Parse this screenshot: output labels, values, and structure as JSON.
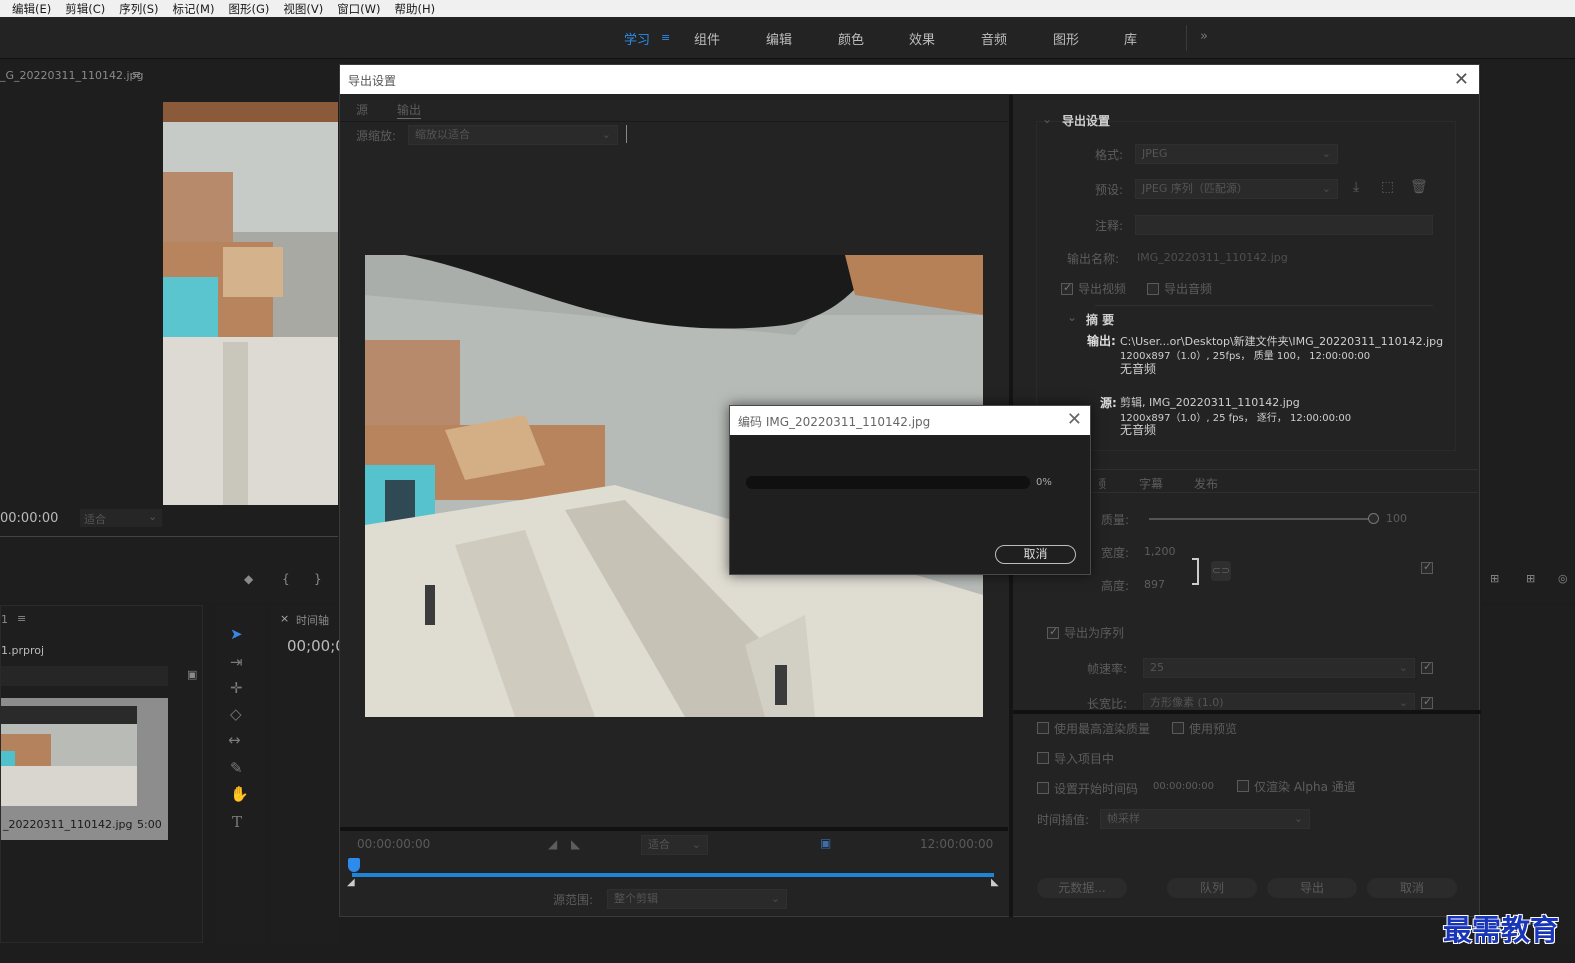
{
  "menu": [
    "编辑(E)",
    "剪辑(C)",
    "序列(S)",
    "标记(M)",
    "图形(G)",
    "视图(V)",
    "窗口(W)",
    "帮助(H)"
  ],
  "workspaces": {
    "learn": "学习",
    "assembly": "组件",
    "editing": "编辑",
    "color": "颜色",
    "effects": "效果",
    "audio": "音频",
    "graphics": "图形",
    "libraries": "库",
    "more": "»"
  },
  "source_monitor": {
    "clip_name": "_G_20220311_110142.jpg",
    "timecode": "00:00:00",
    "fit": "适合"
  },
  "project_panel": {
    "tab": "1",
    "project_file": "1.prproj",
    "clip_name": "_20220311_110142.jpg",
    "clip_duration": "5:00"
  },
  "timeline_panel": {
    "tab": "时间轴",
    "timecode": "00;00;0"
  },
  "export_dialog": {
    "title": "导出设置",
    "tab_source": "源",
    "tab_output": "输出",
    "source_scaling_label": "源缩放:",
    "source_scaling_value": "缩放以适合",
    "timecode_start": "00:00:00:00",
    "timecode_end": "12:00:00:00",
    "fit_value": "适合",
    "source_range_label": "源范围:",
    "source_range_value": "整个剪辑",
    "settings_header": "导出设置",
    "format_label": "格式:",
    "format_value": "JPEG",
    "preset_label": "预设:",
    "preset_value": "JPEG 序列（匹配源）",
    "comments_label": "注释:",
    "output_name_label": "输出名称:",
    "output_name_value": "IMG_20220311_110142.jpg",
    "export_video": "导出视频",
    "export_audio": "导出音频",
    "summary_header": "摘 要",
    "summary_output_label": "输出:",
    "summary_output_path": "C:\\User...or\\Desktop\\新建文件夹\\IMG_20220311_110142.jpg",
    "summary_output_line2": "1200x897（1.0）, 25fps， 质量 100， 12:00:00:00",
    "summary_output_line3": "无音频",
    "summary_source_label": "源:",
    "summary_source_line1": "剪辑, IMG_20220311_110142.jpg",
    "summary_source_line2": "1200x897（1.0）, 25 fps， 逐行， 12:00:00:00",
    "summary_source_line3": "无音频",
    "tab_video": "视频",
    "tab_captions": "字幕",
    "tab_publish": "发布",
    "quality_label": "质量:",
    "quality_value": "100",
    "width_label": "宽度:",
    "width_value": "1,200",
    "height_label": "高度:",
    "height_value": "897",
    "export_as_sequence": "导出为序列",
    "frame_rate_label": "帧速率:",
    "frame_rate_value": "25",
    "aspect_label": "长宽比:",
    "aspect_value": "方形像素 (1.0)",
    "max_render_quality": "使用最高渲染质量",
    "use_previews": "使用预览",
    "import_into_project": "导入项目中",
    "set_start_timecode": "设置开始时间码",
    "start_timecode_value": "00:00:00:00",
    "render_alpha_only": "仅渲染 Alpha 通道",
    "time_interpolation_label": "时间插值:",
    "time_interpolation_value": "帧采样",
    "metadata_button": "元数据...",
    "queue_button": "队列",
    "export_button": "导出",
    "cancel_button": "取消"
  },
  "encode_dialog": {
    "title": "编码 IMG_20220311_110142.jpg",
    "progress_percent": "0%",
    "progress_value": 0,
    "cancel": "取消"
  },
  "watermark": "最需教育",
  "colors": {
    "accent": "#2d8ceb",
    "panel_bg": "#1e1e1e",
    "dialog_bg": "#232323",
    "watermark": "#1936b8"
  }
}
